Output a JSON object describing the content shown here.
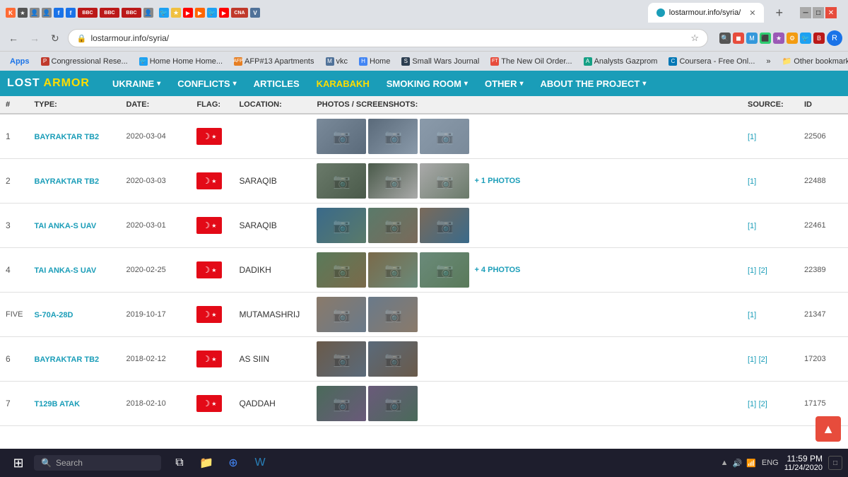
{
  "browser": {
    "tab_title": "lostarmour.info/syria/",
    "address": "lostarmour.info/syria/",
    "new_tab_label": "+",
    "nav_back": "←",
    "nav_forward": "→",
    "nav_refresh": "↻",
    "bookmarks": [
      {
        "label": "Apps",
        "favicon": "A"
      },
      {
        "label": "Congressional Rese...",
        "favicon": "C"
      },
      {
        "label": "Home Home Home...",
        "favicon": "H"
      },
      {
        "label": "AFP#13 Apartments",
        "favicon": "A"
      },
      {
        "label": "vkc",
        "favicon": "M"
      },
      {
        "label": "Home",
        "favicon": "H"
      },
      {
        "label": "Small Wars Journal",
        "favicon": "S"
      },
      {
        "label": "The New Oil Order...",
        "favicon": "F"
      },
      {
        "label": "Analysts Gazprom",
        "favicon": "G"
      },
      {
        "label": "Coursera - Free Onl...",
        "favicon": "C"
      },
      {
        "label": "»",
        "favicon": ""
      },
      {
        "label": "Other bookmarks",
        "favicon": ""
      }
    ],
    "window_controls": [
      "minimize",
      "maximize",
      "close"
    ]
  },
  "site": {
    "logo_text": "LOST",
    "logo_accent": "ARMOR",
    "nav_items": [
      {
        "label": "UKRAINE",
        "has_dropdown": true,
        "active": false
      },
      {
        "label": "CONFLICTS",
        "has_dropdown": true,
        "active": false
      },
      {
        "label": "ARTICLES",
        "has_dropdown": false,
        "active": false
      },
      {
        "label": "KARABAKH",
        "has_dropdown": false,
        "active": true
      },
      {
        "label": "SMOKING ROOM",
        "has_dropdown": true,
        "active": false
      },
      {
        "label": "OTHER",
        "has_dropdown": true,
        "active": false
      },
      {
        "label": "ABOUT THE PROJECT",
        "has_dropdown": true,
        "active": false
      }
    ]
  },
  "table": {
    "headers": [
      "#",
      "TYPE:",
      "DATE:",
      "FLAG:",
      "LOCATION:",
      "PHOTOS / SCREENSHOTS:",
      "SOURCE:",
      "ID"
    ],
    "rows": [
      {
        "num": "1",
        "type": "BAYRAKTAR TB2",
        "date": "2020-03-04",
        "flag": "turkey",
        "location": "",
        "photos_count": 3,
        "more_photos": "",
        "sources": [
          "[1]"
        ],
        "id": "22506"
      },
      {
        "num": "2",
        "type": "BAYRAKTAR TB2",
        "date": "2020-03-03",
        "flag": "turkey",
        "location": "SARAQIB",
        "photos_count": 3,
        "more_photos": "+ 1 PHOTOS",
        "sources": [
          "[1]"
        ],
        "id": "22488"
      },
      {
        "num": "3",
        "type": "TAI ANKA-S UAV",
        "date": "2020-03-01",
        "flag": "turkey",
        "location": "SARAQIB",
        "photos_count": 3,
        "more_photos": "",
        "sources": [
          "[1]"
        ],
        "id": "22461"
      },
      {
        "num": "4",
        "type": "TAI ANKA-S UAV",
        "date": "2020-02-25",
        "flag": "turkey",
        "location": "DADIKH",
        "photos_count": 3,
        "more_photos": "+ 4 PHOTOS",
        "sources": [
          "[1]",
          "[2]"
        ],
        "id": "22389"
      },
      {
        "num": "FIVE",
        "type": "S-70A-28D",
        "date": "2019-10-17",
        "flag": "turkey",
        "location": "MUTAMASHRIJ",
        "photos_count": 2,
        "more_photos": "",
        "sources": [
          "[1]"
        ],
        "id": "21347"
      },
      {
        "num": "6",
        "type": "BAYRAKTAR TB2",
        "date": "2018-02-12",
        "flag": "turkey",
        "location": "AS SIIN",
        "photos_count": 2,
        "more_photos": "",
        "sources": [
          "[1]",
          "[2]"
        ],
        "id": "17203"
      },
      {
        "num": "7",
        "type": "T129B ATAK",
        "date": "2018-02-10",
        "flag": "turkey",
        "location": "QADDAH",
        "photos_count": 2,
        "more_photos": "",
        "sources": [
          "[1]",
          "[2]"
        ],
        "id": "17175"
      }
    ]
  },
  "taskbar": {
    "search_placeholder": "Search",
    "time": "11:59 PM",
    "date": "11/24/2020",
    "lang": "ENG"
  }
}
